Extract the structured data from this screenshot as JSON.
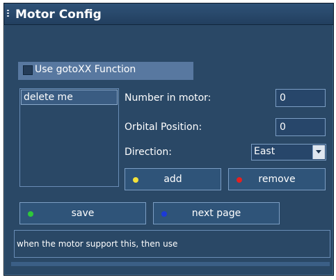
{
  "window": {
    "title": "Motor Config"
  },
  "gotoxx": {
    "label": "Use gotoXX Function",
    "checked": false
  },
  "list": {
    "items": [
      "delete me"
    ]
  },
  "number_in_motor": {
    "label": "Number in motor:",
    "value": "0"
  },
  "orbital_position": {
    "label": "Orbital Position:",
    "value": "0"
  },
  "direction": {
    "label": "Direction:",
    "value": "East"
  },
  "buttons": {
    "add": {
      "label": "add",
      "dot_color": "#f4e23a"
    },
    "remove": {
      "label": "remove",
      "dot_color": "#e42020"
    },
    "save": {
      "label": "save",
      "dot_color": "#2ec83a"
    },
    "next_page": {
      "label": "next page",
      "dot_color": "#1c3ad8"
    }
  },
  "status": {
    "text": "when the motor support this, then use"
  },
  "colors": {
    "background": "#2a4866",
    "accent": "#5878a0"
  }
}
